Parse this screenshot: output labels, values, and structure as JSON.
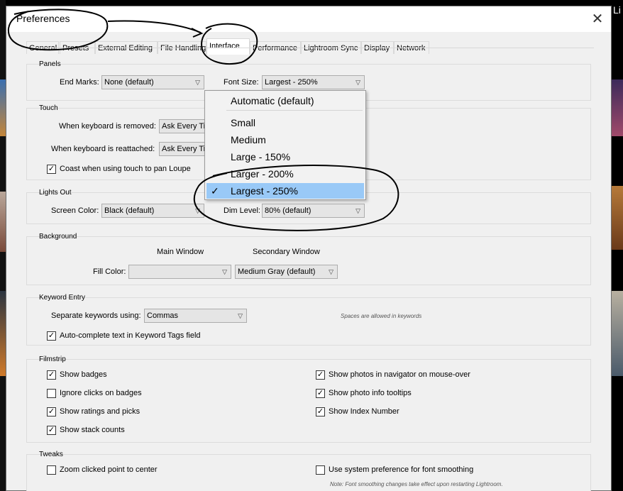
{
  "background": {
    "corner_text": "Li"
  },
  "dialog": {
    "title": "Preferences",
    "close_glyph": "✕",
    "tabs": [
      {
        "label": "General"
      },
      {
        "label": "Presets"
      },
      {
        "label": "External Editing"
      },
      {
        "label": "File Handling"
      },
      {
        "label": "Interface",
        "active": true
      },
      {
        "label": "Performance"
      },
      {
        "label": "Lightroom Sync"
      },
      {
        "label": "Display"
      },
      {
        "label": "Network"
      }
    ]
  },
  "panels": {
    "title": "Panels",
    "end_marks_label": "End Marks:",
    "end_marks_value": "None (default)",
    "font_size_label": "Font Size:",
    "font_size_value": "Largest - 250%"
  },
  "touch": {
    "title": "Touch",
    "removed_label": "When keyboard is removed:",
    "removed_value": "Ask Every Tir",
    "reattached_label": "When keyboard is reattached:",
    "reattached_value": "Ask Every Tir",
    "coast_label": "Coast when using touch to pan Loupe",
    "coast_checked": true
  },
  "lights_out": {
    "title": "Lights Out",
    "screen_color_label": "Screen Color:",
    "screen_color_value": "Black (default)",
    "dim_level_label": "Dim Level:",
    "dim_level_value": "80% (default)"
  },
  "background_group": {
    "title": "Background",
    "main_window_label": "Main Window",
    "secondary_window_label": "Secondary Window",
    "fill_color_label": "Fill Color:",
    "main_fill_value": "",
    "secondary_fill_value": "Medium Gray (default)"
  },
  "keyword_entry": {
    "title": "Keyword Entry",
    "separate_label": "Separate keywords using:",
    "separate_value": "Commas",
    "spaces_note": "Spaces are allowed in keywords",
    "autocomplete_label": "Auto-complete text in Keyword Tags field",
    "autocomplete_checked": true
  },
  "filmstrip": {
    "title": "Filmstrip",
    "left": [
      {
        "label": "Show badges",
        "checked": true
      },
      {
        "label": "Ignore clicks on badges",
        "checked": false
      },
      {
        "label": "Show ratings and picks",
        "checked": true
      },
      {
        "label": "Show stack counts",
        "checked": true
      }
    ],
    "right": [
      {
        "label": "Show photos in navigator on mouse-over",
        "checked": true
      },
      {
        "label": "Show photo info tooltips",
        "checked": true
      },
      {
        "label": "Show Index Number",
        "checked": true
      }
    ]
  },
  "tweaks": {
    "title": "Tweaks",
    "zoom_label": "Zoom clicked point to center",
    "zoom_checked": false,
    "font_smoothing_label": "Use system preference for font smoothing",
    "font_smoothing_checked": false,
    "note": "Note: Font smoothing changes take effect upon restarting Lightroom."
  },
  "font_size_dropdown": {
    "items": [
      {
        "label": "Automatic (default)"
      },
      {
        "label": "Small"
      },
      {
        "label": "Medium"
      },
      {
        "label": "Large - 150%"
      },
      {
        "label": "Larger - 200%"
      },
      {
        "label": "Largest - 250%",
        "selected": true
      }
    ],
    "check_glyph": "✓"
  },
  "colors": {
    "selection_highlight": "#99c9f7",
    "annotation_ink": "#000000"
  }
}
